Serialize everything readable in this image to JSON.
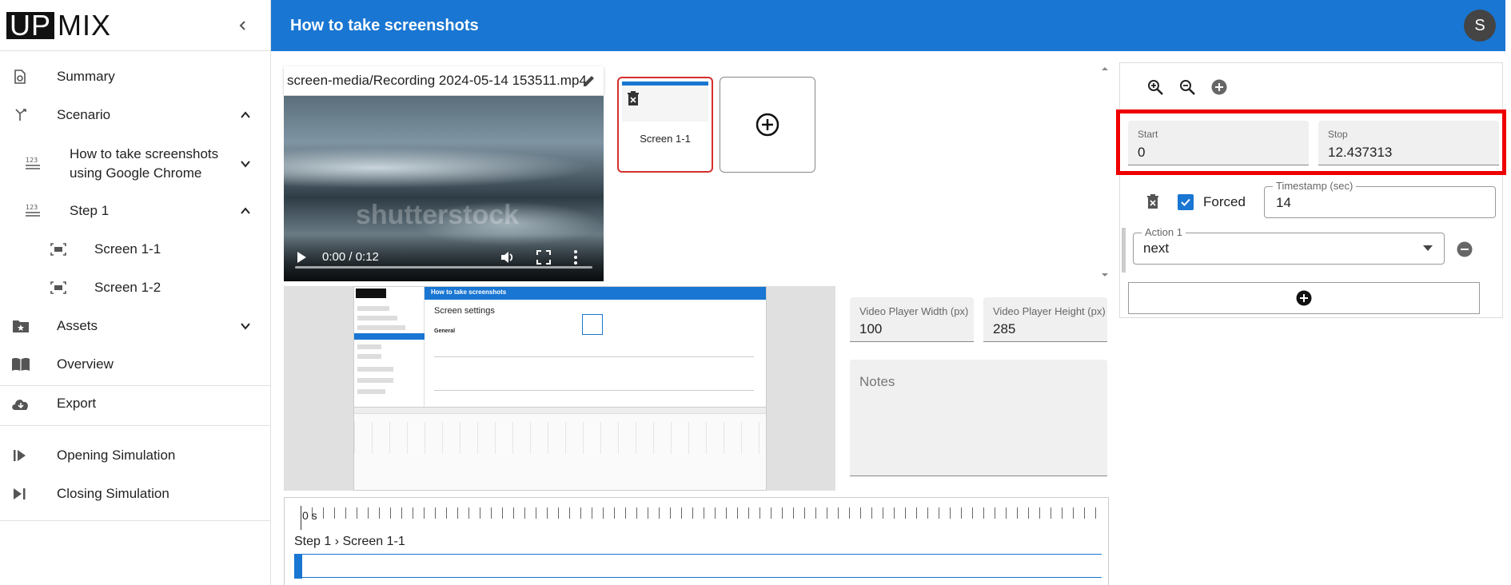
{
  "app": {
    "logo_up": "UP",
    "logo_mix": "MIX"
  },
  "sidebar": {
    "items": [
      {
        "label": "Summary"
      },
      {
        "label": "Scenario"
      },
      {
        "label": "How to take screenshots using Google Chrome"
      },
      {
        "label": "Step 1"
      },
      {
        "label": "Screen 1-1"
      },
      {
        "label": "Screen 1-2"
      },
      {
        "label": "Assets"
      },
      {
        "label": "Overview"
      },
      {
        "label": "Export"
      },
      {
        "label": "Opening Simulation"
      },
      {
        "label": "Closing Simulation"
      }
    ]
  },
  "header": {
    "title": "How to take screenshots",
    "avatar_initial": "S"
  },
  "media": {
    "file_name": "screen-media/Recording 2024-05-14 153511.mp4",
    "time": "0:00 / 0:12",
    "watermark": "shutterstock"
  },
  "screens": [
    {
      "label": "Screen 1-1"
    }
  ],
  "dimensions": {
    "width_label": "Video Player Width (px)",
    "width_value": "100",
    "height_label": "Video Player Height (px)",
    "height_value": "285",
    "notes_placeholder": "Notes"
  },
  "timeline": {
    "zero_label": "0 s",
    "step_label": "Step 1 › Screen 1-1"
  },
  "inspector": {
    "start_label": "Start",
    "start_value": "0",
    "stop_label": "Stop",
    "stop_value": "12.437313",
    "forced_label": "Forced",
    "forced_checked": true,
    "timestamp_label": "Timestamp (sec)",
    "timestamp_value": "14",
    "action_label": "Action 1",
    "action_value": "next"
  },
  "preview": {
    "title": "How to take screenshots",
    "heading": "Screen settings",
    "general": "General"
  },
  "colors": {
    "primary": "#1976d2",
    "highlight": "#ee0000",
    "selected_card": "#d32f2f"
  }
}
